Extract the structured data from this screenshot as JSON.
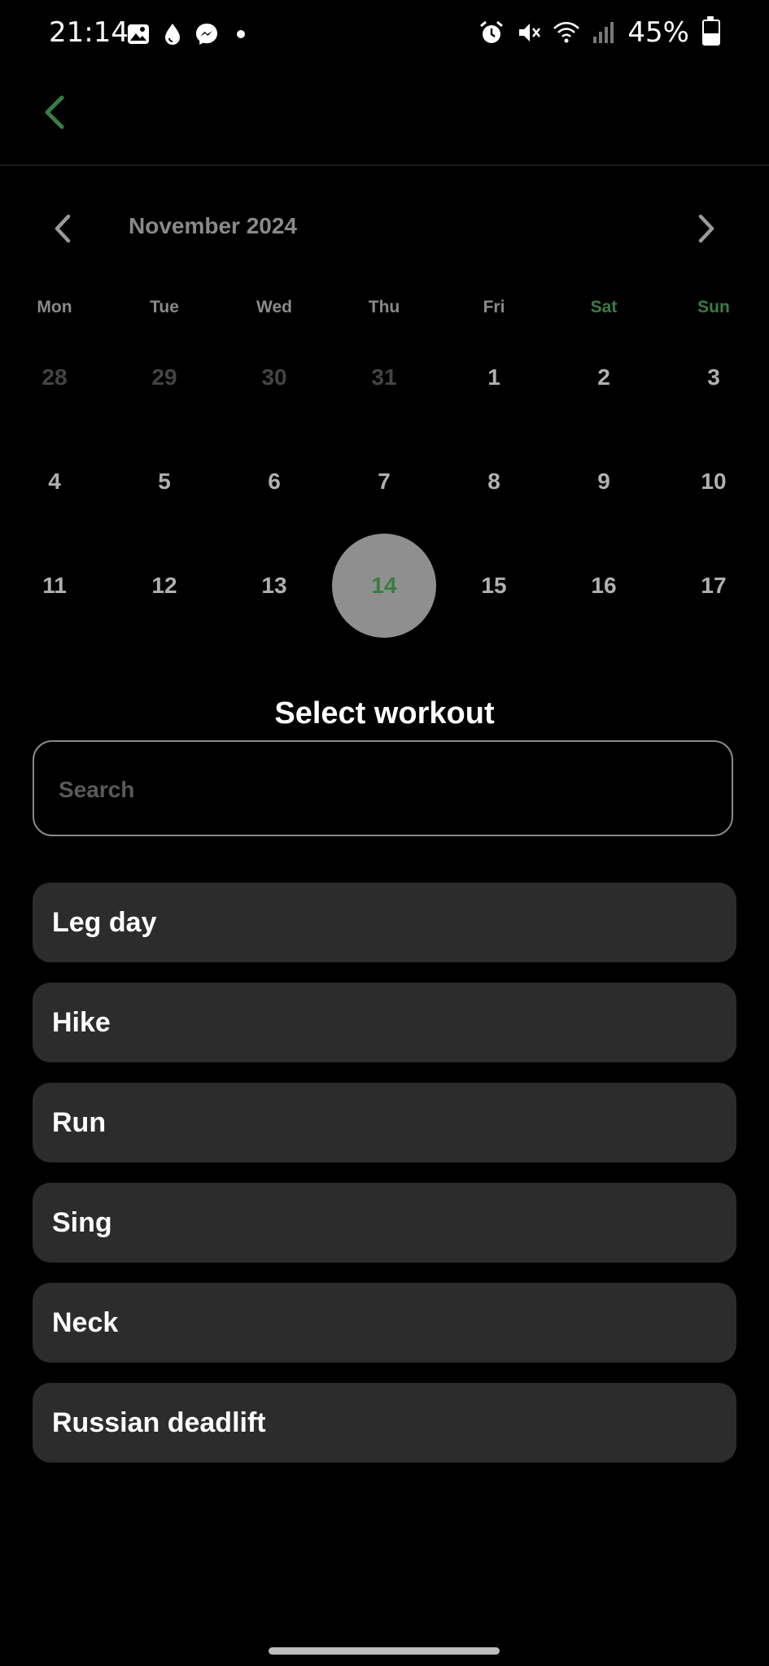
{
  "status_bar": {
    "time": "21:14",
    "battery": "45%",
    "battery_level": 0.45,
    "left_icons": [
      "gallery-icon",
      "drop-icon",
      "messenger-icon",
      "dot-icon"
    ],
    "right_icons": [
      "alarm-icon",
      "mute-icon",
      "wifi-icon",
      "signal-icon",
      "battery-icon"
    ]
  },
  "app_bar": {
    "back_icon": "chevron-left-icon",
    "accent_color": "#3a7d44"
  },
  "calendar": {
    "month_label": "November 2024",
    "prev_icon": "chevron-left-icon",
    "next_icon": "chevron-right-icon",
    "weekdays": [
      "Mon",
      "Tue",
      "Wed",
      "Thu",
      "Fri",
      "Sat",
      "Sun"
    ],
    "weeks": [
      [
        "28",
        "29",
        "30",
        "31",
        "1",
        "2",
        "3"
      ],
      [
        "4",
        "5",
        "6",
        "7",
        "8",
        "9",
        "10"
      ],
      [
        "11",
        "12",
        "13",
        "14",
        "15",
        "16",
        "17"
      ]
    ],
    "selected_day": "14",
    "weekend_color": "#3a7d44"
  },
  "workout": {
    "title": "Select workout",
    "search_placeholder": "Search",
    "search_value": "",
    "items": [
      {
        "label": "Leg day"
      },
      {
        "label": "Hike"
      },
      {
        "label": "Run"
      },
      {
        "label": "Sing"
      },
      {
        "label": "Neck"
      },
      {
        "label": "Russian deadlift"
      }
    ]
  }
}
